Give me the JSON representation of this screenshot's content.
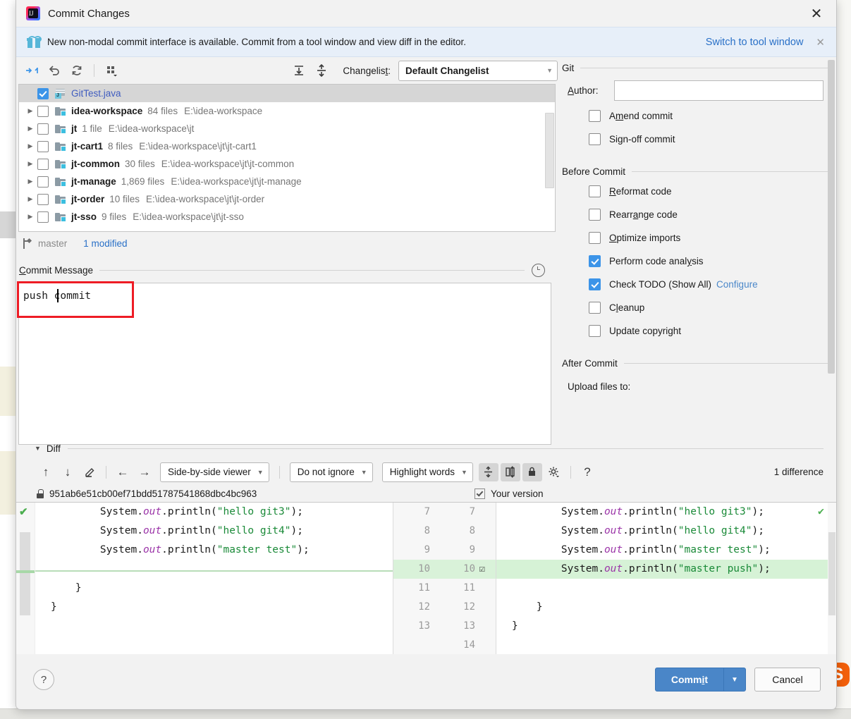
{
  "window": {
    "title": "Commit Changes",
    "close_label": "✕"
  },
  "notification": {
    "icon": "gift-icon",
    "message": "New non-modal commit interface is available. Commit from a tool window and view diff in the editor.",
    "action": "Switch to tool window",
    "close": "✕"
  },
  "toolbar": {
    "icons": [
      "move-to-changelist-icon",
      "rollback-icon",
      "refresh-icon",
      "group-by-icon"
    ],
    "expand_all_icon": "expand-all-icon",
    "collapse_all_icon": "collapse-all-icon",
    "changelist_label": "Changelist:",
    "changelist_value": "Default Changelist",
    "dropdown_arrow": "▼"
  },
  "tree": {
    "rows": [
      {
        "name": "GitTest.java",
        "count": "",
        "path": "",
        "checked": true,
        "selected": true,
        "type": "java",
        "modified": true,
        "twisty": ""
      },
      {
        "name": "idea-workspace",
        "count": "84 files",
        "path": "E:\\idea-workspace",
        "checked": false,
        "selected": false,
        "type": "folder",
        "modified": false,
        "twisty": "▶"
      },
      {
        "name": "jt",
        "count": "1 file",
        "path": "E:\\idea-workspace\\jt",
        "checked": false,
        "selected": false,
        "type": "folder",
        "modified": false,
        "twisty": "▶"
      },
      {
        "name": "jt-cart1",
        "count": "8 files",
        "path": "E:\\idea-workspace\\jt\\jt-cart1",
        "checked": false,
        "selected": false,
        "type": "folder",
        "modified": false,
        "twisty": "▶"
      },
      {
        "name": "jt-common",
        "count": "30 files",
        "path": "E:\\idea-workspace\\jt\\jt-common",
        "checked": false,
        "selected": false,
        "type": "folder",
        "modified": false,
        "twisty": "▶"
      },
      {
        "name": "jt-manage",
        "count": "1,869 files",
        "path": "E:\\idea-workspace\\jt\\jt-manage",
        "checked": false,
        "selected": false,
        "type": "folder",
        "modified": false,
        "twisty": "▶"
      },
      {
        "name": "jt-order",
        "count": "10 files",
        "path": "E:\\idea-workspace\\jt\\jt-order",
        "checked": false,
        "selected": false,
        "type": "folder",
        "modified": false,
        "twisty": "▶"
      },
      {
        "name": "jt-sso",
        "count": "9 files",
        "path": "E:\\idea-workspace\\jt\\jt-sso",
        "checked": false,
        "selected": false,
        "type": "folder",
        "modified": false,
        "twisty": "▶"
      }
    ]
  },
  "branch_bar": {
    "icon": "branch-icon",
    "branch": "master",
    "modified_count": "1 modified"
  },
  "commit_message": {
    "label": "Commit Message",
    "history_icon": "history-clock-icon",
    "value": "push commit",
    "caret_after": "push",
    "highlight_color": "#ee1c25"
  },
  "right_panel": {
    "git": {
      "title": "Git",
      "author_label": "Author:",
      "author_value": "",
      "checkboxes": [
        {
          "label": "Amend commit",
          "checked": false
        },
        {
          "label": "Sign-off commit",
          "checked": false
        }
      ]
    },
    "before_commit": {
      "title": "Before Commit",
      "checkboxes": [
        {
          "label": "Reformat code",
          "checked": false,
          "link": ""
        },
        {
          "label": "Rearrange code",
          "checked": false,
          "link": ""
        },
        {
          "label": "Optimize imports",
          "checked": false,
          "link": ""
        },
        {
          "label": "Perform code analysis",
          "checked": true,
          "link": ""
        },
        {
          "label": "Check TODO (Show All)",
          "checked": true,
          "link": "Configure"
        },
        {
          "label": "Cleanup",
          "checked": false,
          "link": ""
        },
        {
          "label": "Update copyright",
          "checked": false,
          "link": ""
        }
      ]
    },
    "after_commit": {
      "title": "After Commit",
      "upload_label": "Upload files to:"
    }
  },
  "diff": {
    "section_title": "Diff",
    "caret": "▼",
    "buttons": [
      "previous-difference-icon",
      "next-difference-icon",
      "edit-icon",
      "accept-left-icon",
      "accept-right-icon"
    ],
    "viewer_mode": "Side-by-side viewer",
    "ignore_mode": "Do not ignore",
    "highlight_mode": "Highlight words",
    "toggle_icons": [
      "collapse-unchanged-icon",
      "sync-scroll-icon",
      "read-only-lock-icon",
      "settings-gear-icon",
      "help-icon"
    ],
    "difference_count": "1 difference",
    "left_header_hash": "951ab6e51cb00ef71bdd51787541868dbc4bc963",
    "left_lock_icon": "lock-icon",
    "right_header_label": "Your version",
    "right_header_checked": true,
    "left_lines": [
      {
        "text": "        System.out.println(\"hello git3\");",
        "type": "ctx"
      },
      {
        "text": "        System.out.println(\"hello git4\");",
        "type": "ctx"
      },
      {
        "text": "        System.out.println(\"master test\");",
        "type": "ctx"
      },
      {
        "text": "",
        "type": "gap"
      },
      {
        "text": "    }",
        "type": "ctx"
      },
      {
        "text": "}",
        "type": "ctx"
      }
    ],
    "right_lines": [
      {
        "text": "        System.out.println(\"hello git3\");",
        "type": "ctx"
      },
      {
        "text": "        System.out.println(\"hello git4\");",
        "type": "ctx"
      },
      {
        "text": "        System.out.println(\"master test\");",
        "type": "ctx"
      },
      {
        "text": "        System.out.println(\"master push\");",
        "type": "add"
      },
      {
        "text": "",
        "type": "ctx"
      },
      {
        "text": "    }",
        "type": "ctx"
      },
      {
        "text": "}",
        "type": "ctx"
      }
    ],
    "line_numbers": [
      {
        "left": "7",
        "right": "7",
        "add": false
      },
      {
        "left": "8",
        "right": "8",
        "add": false
      },
      {
        "left": "9",
        "right": "9",
        "add": false
      },
      {
        "left": "10",
        "right": "10",
        "add": true
      },
      {
        "left": "11",
        "right": "11",
        "add": false
      },
      {
        "left": "12",
        "right": "12",
        "add": false
      },
      {
        "left": "13",
        "right": "13",
        "add": false
      },
      {
        "left": "",
        "right": "14",
        "add": false
      }
    ],
    "added_line_color": "#d6f2d6"
  },
  "footer": {
    "help_label": "?",
    "commit_label": "Commit",
    "commit_dropdown": "▼",
    "cancel_label": "Cancel",
    "accent_color": "#4a86c8"
  },
  "background": {
    "ime_badge": "S"
  }
}
